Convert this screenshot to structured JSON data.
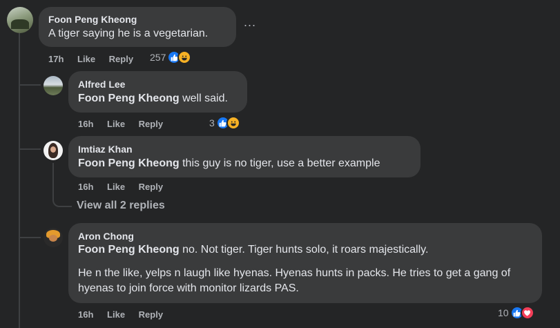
{
  "comments": [
    {
      "author": "Foon Peng Kheong",
      "text": "A tiger saying he is a vegetarian.",
      "time": "17h",
      "like": "Like",
      "reply": "Reply",
      "reaction_count": "257",
      "more": "..."
    },
    {
      "author": "Alfred Lee",
      "mention": "Foon Peng Kheong",
      "text": " well said.",
      "time": "16h",
      "like": "Like",
      "reply": "Reply",
      "reaction_count": "3"
    },
    {
      "author": "Imtiaz Khan",
      "mention": "Foon Peng Kheong",
      "text": " this guy is no tiger, use a better example",
      "time": "16h",
      "like": "Like",
      "reply": "Reply",
      "view_replies": "View all 2 replies"
    },
    {
      "author": "Aron Chong",
      "mention": "Foon Peng Kheong",
      "text": " no. Not tiger. Tiger hunts solo, it roars majestically.",
      "text2": "He n the like, yelps n laugh like hyenas. Hyenas hunts in packs. He tries to get a gang of hyenas to join force with monitor lizards PAS.",
      "time": "16h",
      "like": "Like",
      "reply": "Reply",
      "reaction_count": "10"
    }
  ],
  "colors": {
    "background": "#242526",
    "bubble": "#3a3b3c",
    "text": "#e4e6eb",
    "muted": "#b0b3b8",
    "like_blue": "#1877f2",
    "haha_yellow": "#f7b125",
    "love_red": "#f33e58"
  },
  "icons": [
    "like-icon",
    "haha-icon",
    "love-icon",
    "more-options-icon"
  ]
}
